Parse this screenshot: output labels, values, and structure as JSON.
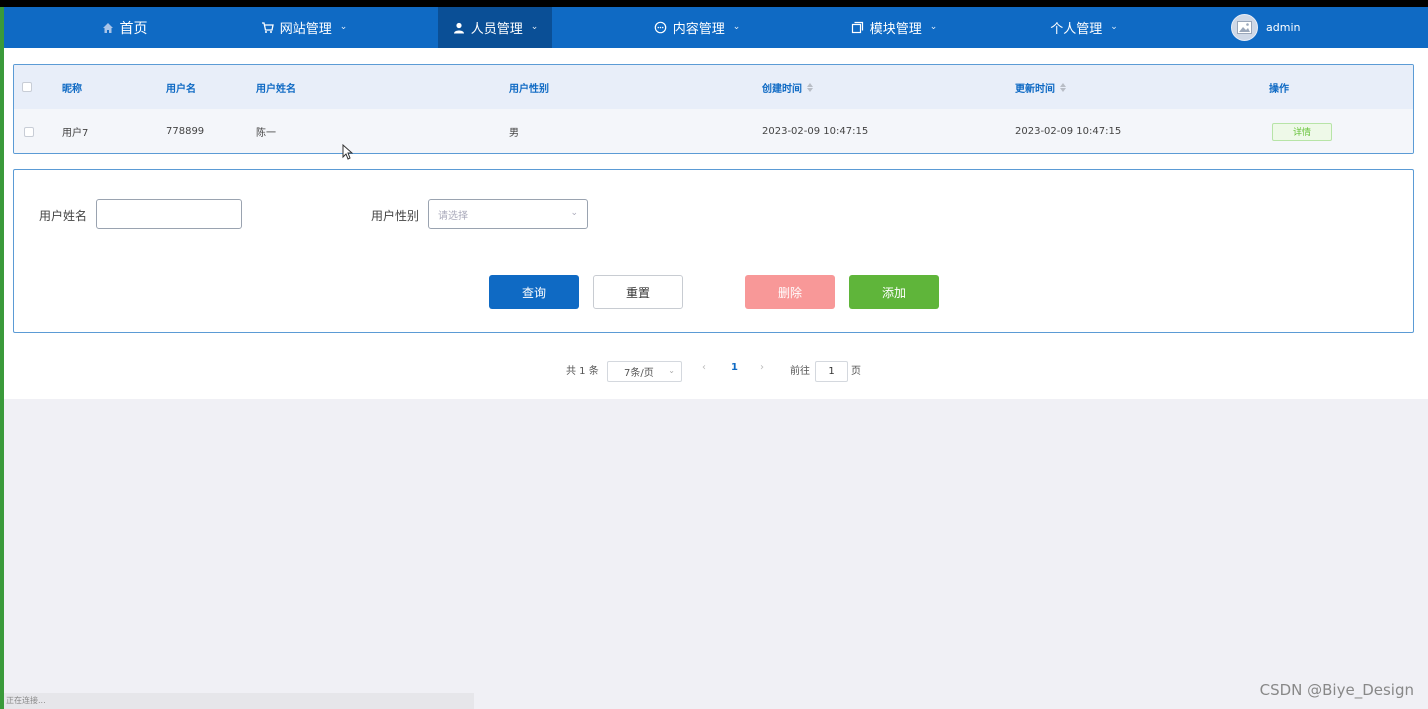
{
  "nav": {
    "items": [
      {
        "label": "首页",
        "icon": "home-icon"
      },
      {
        "label": "网站管理",
        "icon": "cart-icon"
      },
      {
        "label": "人员管理",
        "icon": "person-icon"
      },
      {
        "label": "内容管理",
        "icon": "chat-icon"
      },
      {
        "label": "模块管理",
        "icon": "copy-icon"
      },
      {
        "label": "个人管理",
        "icon": ""
      }
    ],
    "active_index": 2,
    "user": "admin",
    "bg_color": "#0f6ac4",
    "active_color": "#0a4f96"
  },
  "table": {
    "headers": [
      "昵称",
      "用户名",
      "用户姓名",
      "用户性别",
      "创建时间",
      "更新时间",
      "操作"
    ],
    "rows": [
      {
        "nickname": "用户7",
        "username": "778899",
        "real_name": "陈一",
        "gender": "男",
        "created": "2023-02-09 10:47:15",
        "updated": "2023-02-09 10:47:15",
        "action": "详情"
      }
    ]
  },
  "search": {
    "name_label": "用户姓名",
    "name_value": "",
    "gender_label": "用户性别",
    "gender_placeholder": "请选择",
    "query_button": "查询",
    "reset_button": "重置",
    "delete_button": "删除",
    "add_button": "添加",
    "colors": {
      "query": "#0f6ac4",
      "delete": "#f89898",
      "add": "#5fb53a"
    }
  },
  "pagination": {
    "total_text": "共 1 条",
    "page_size": "7条/页",
    "current_page": "1",
    "goto_label": "前往",
    "goto_value": "1",
    "page_suffix": "页"
  },
  "status_bar": "正在连接...",
  "watermark": "CSDN @Biye_Design"
}
